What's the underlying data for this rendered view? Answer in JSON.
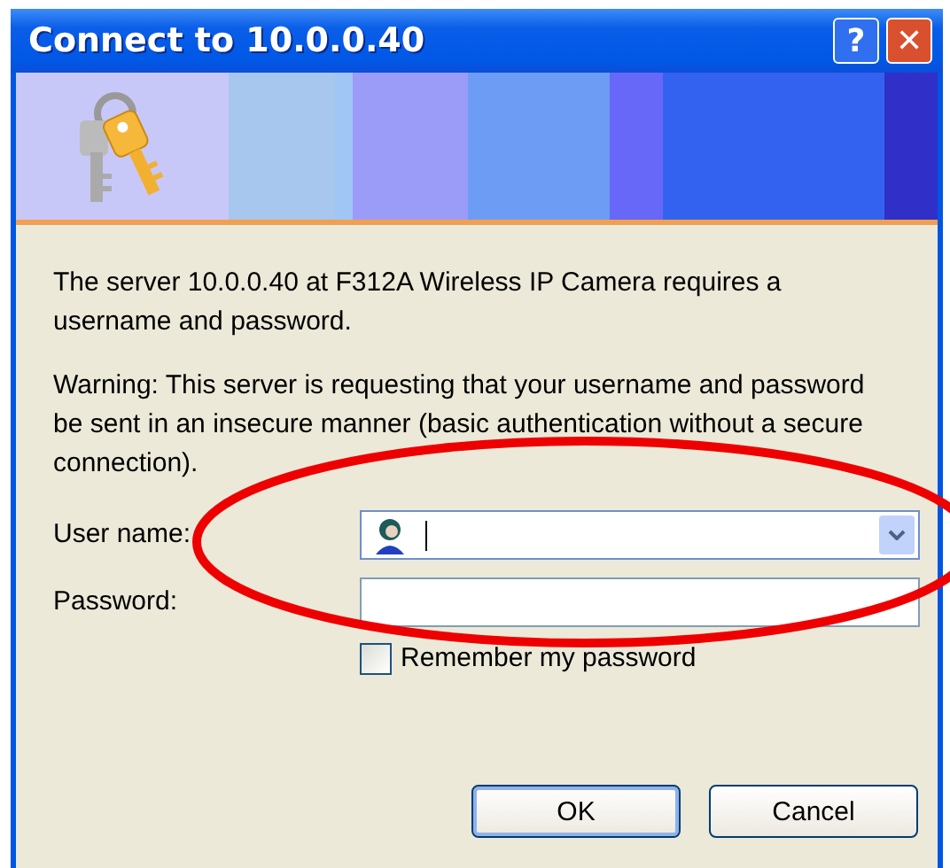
{
  "window": {
    "title": "Connect to 10.0.0.40",
    "title_buttons": [
      "?",
      "✕"
    ]
  },
  "message": "The server 10.0.0.40 at F312A Wireless IP Camera requires a username and password.",
  "warning": "Warning: This server is requesting that your username and password be sent in an insecure manner (basic authentication without a secure connection).",
  "fields": [
    {
      "label": "User name:",
      "kind": "combo",
      "focused": true
    },
    {
      "label": "Password:",
      "kind": "password",
      "focused": false
    }
  ],
  "remember": {
    "label": "Remember my password",
    "checked": false
  },
  "buttons": [
    {
      "label": "OK",
      "default": true
    },
    {
      "label": "Cancel",
      "default": false
    }
  ],
  "annotation": {
    "kind": "ellipse",
    "color": "#ee0000"
  }
}
